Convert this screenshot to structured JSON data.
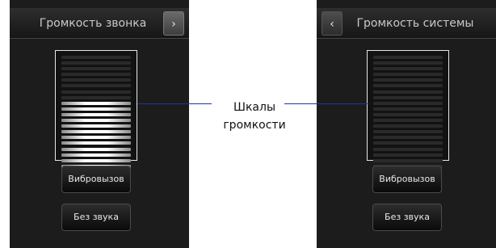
{
  "left_panel": {
    "title": "Громкость звонка",
    "nav_arrow": "›",
    "volume": {
      "total_bars": 20,
      "active_bars": 12
    },
    "vibrate_label": "Вибровызов",
    "silent_label": "Без звука"
  },
  "right_panel": {
    "title": "Громкость системы",
    "nav_arrow": "‹",
    "volume": {
      "total_bars": 20,
      "active_bars": 0
    },
    "vibrate_label": "Вибровызов",
    "silent_label": "Без звука"
  },
  "callout": {
    "line1": "Шкалы",
    "line2": "громкости"
  },
  "colors": {
    "panel_bg": "#1c1c1c",
    "callout_line": "#1a3a9a"
  }
}
